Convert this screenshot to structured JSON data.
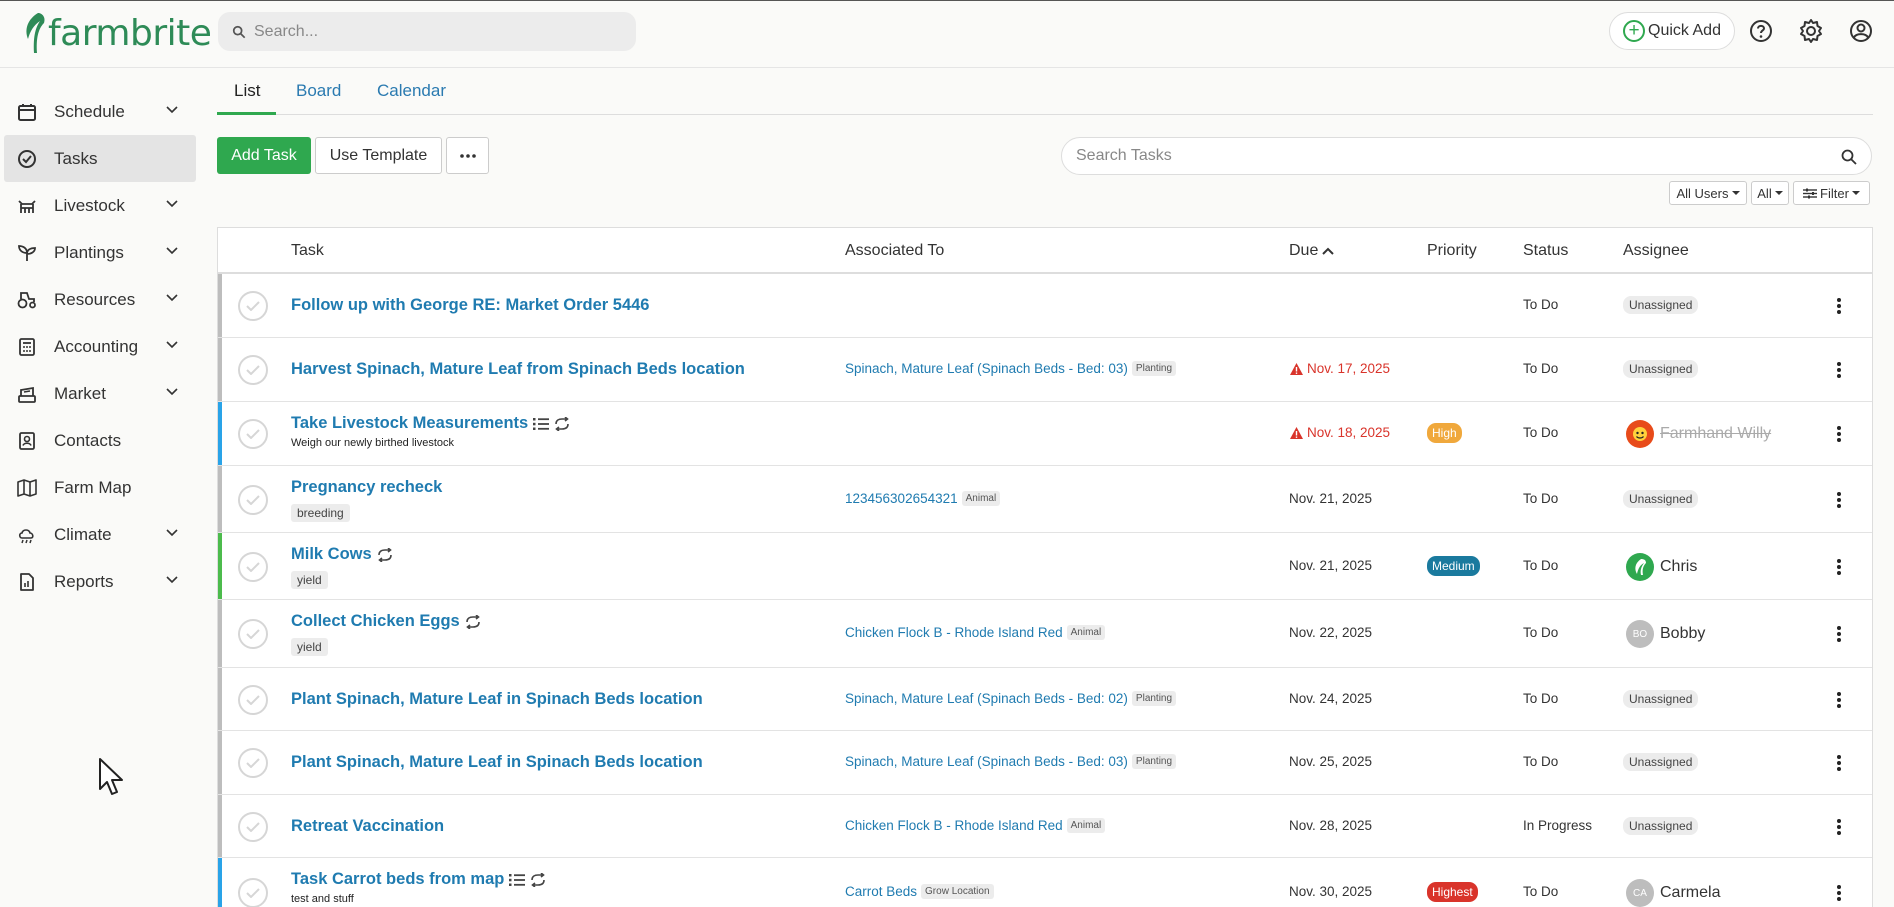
{
  "app": {
    "logo_text": "farmbrite",
    "brand_color": "#2fa84f"
  },
  "search": {
    "placeholder": "Search..."
  },
  "header": {
    "quick_add_label": "Quick Add"
  },
  "sidebar": {
    "items": [
      {
        "label": "Schedule",
        "icon": "calendar-icon",
        "expandable": true
      },
      {
        "label": "Tasks",
        "icon": "check-circle-icon",
        "expandable": false,
        "active": true
      },
      {
        "label": "Livestock",
        "icon": "cow-icon",
        "expandable": true
      },
      {
        "label": "Plantings",
        "icon": "sprout-icon",
        "expandable": true
      },
      {
        "label": "Resources",
        "icon": "tractor-icon",
        "expandable": true
      },
      {
        "label": "Accounting",
        "icon": "calculator-icon",
        "expandable": true
      },
      {
        "label": "Market",
        "icon": "scale-icon",
        "expandable": true
      },
      {
        "label": "Contacts",
        "icon": "contact-book-icon",
        "expandable": false
      },
      {
        "label": "Farm Map",
        "icon": "map-icon",
        "expandable": false
      },
      {
        "label": "Climate",
        "icon": "weather-icon",
        "expandable": true
      },
      {
        "label": "Reports",
        "icon": "report-icon",
        "expandable": true
      }
    ]
  },
  "tabs": [
    {
      "label": "List",
      "active": true
    },
    {
      "label": "Board"
    },
    {
      "label": "Calendar"
    }
  ],
  "toolbar": {
    "add_task": "Add Task",
    "use_template": "Use Template",
    "task_search_placeholder": "Search Tasks",
    "filter_users": "All Users",
    "filter_all": "All",
    "filter": "Filter"
  },
  "table": {
    "headers": {
      "task": "Task",
      "associated": "Associated To",
      "due": "Due",
      "priority": "Priority",
      "status": "Status",
      "assignee": "Assignee"
    },
    "rows": [
      {
        "title": "Follow up with George RE: Market Order 5446",
        "bar_color": "#bdbdbd",
        "assoc": "",
        "assoc_type": "",
        "due": "",
        "overdue": false,
        "priority": "",
        "status": "To Do",
        "assignee": "Unassigned"
      },
      {
        "title": "Harvest Spinach, Mature Leaf from Spinach Beds location",
        "bar_color": "#bdbdbd",
        "assoc": "Spinach, Mature Leaf (Spinach Beds - Bed: 03)",
        "assoc_type": "Planting",
        "due": "Nov. 17, 2025",
        "overdue": true,
        "priority": "",
        "status": "To Do",
        "assignee": "Unassigned"
      },
      {
        "title": "Take Livestock Measurements",
        "desc": "Weigh our newly birthed livestock",
        "bar_color": "#29a3e8",
        "assoc": "",
        "assoc_type": "",
        "due": "Nov. 18, 2025",
        "overdue": true,
        "priority": "High",
        "priority_color": "#f0a83c",
        "status": "To Do",
        "assignee": "Farmhand Willy"
      },
      {
        "title": "Pregnancy recheck",
        "tag": "breeding",
        "bar_color": "#bdbdbd",
        "assoc": "123456302654321",
        "assoc_type": "Animal",
        "due": "Nov. 21, 2025",
        "overdue": false,
        "priority": "",
        "status": "To Do",
        "assignee": "Unassigned"
      },
      {
        "title": "Milk Cows",
        "tag": "yield",
        "bar_color": "#4cbb4c",
        "assoc": "",
        "assoc_type": "",
        "due": "Nov. 21, 2025",
        "overdue": false,
        "priority": "Medium",
        "priority_color": "#1a7a9e",
        "status": "To Do",
        "assignee": "Chris"
      },
      {
        "title": "Collect Chicken Eggs",
        "tag": "yield",
        "bar_color": "#bdbdbd",
        "assoc": "Chicken Flock B - Rhode Island Red",
        "assoc_type": "Animal",
        "due": "Nov. 22, 2025",
        "overdue": false,
        "priority": "",
        "status": "To Do",
        "assignee": "Bobby",
        "assignee_initials": "BO"
      },
      {
        "title": "Plant Spinach, Mature Leaf in Spinach Beds location",
        "bar_color": "#bdbdbd",
        "assoc": "Spinach, Mature Leaf (Spinach Beds - Bed: 02)",
        "assoc_type": "Planting",
        "due": "Nov. 24, 2025",
        "overdue": false,
        "priority": "",
        "status": "To Do",
        "assignee": "Unassigned"
      },
      {
        "title": "Plant Spinach, Mature Leaf in Spinach Beds location",
        "bar_color": "#bdbdbd",
        "assoc": "Spinach, Mature Leaf (Spinach Beds - Bed: 03)",
        "assoc_type": "Planting",
        "due": "Nov. 25, 2025",
        "overdue": false,
        "priority": "",
        "status": "To Do",
        "assignee": "Unassigned"
      },
      {
        "title": "Retreat Vaccination",
        "bar_color": "#bdbdbd",
        "assoc": "Chicken Flock B - Rhode Island Red",
        "assoc_type": "Animal",
        "due": "Nov. 28, 2025",
        "overdue": false,
        "priority": "",
        "status": "In Progress",
        "assignee": "Unassigned"
      },
      {
        "title": "Task Carrot beds from map",
        "desc": "test and stuff",
        "bar_color": "#29a3e8",
        "assoc": "Carrot Beds",
        "assoc_type": "Grow Location",
        "due": "Nov. 30, 2025",
        "overdue": false,
        "priority": "Highest",
        "priority_color": "#d9342b",
        "status": "To Do",
        "assignee": "Carmela",
        "assignee_initials": "CA"
      }
    ]
  }
}
